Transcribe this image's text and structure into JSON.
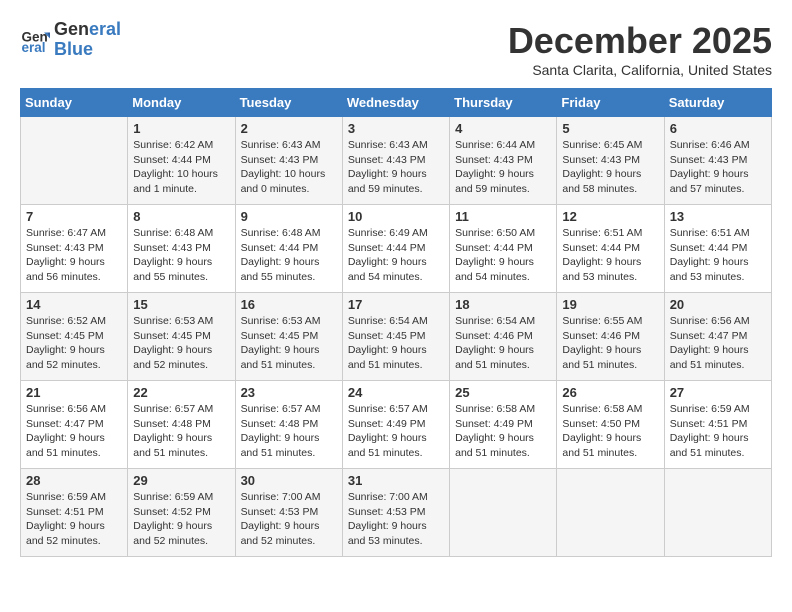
{
  "header": {
    "logo_line1": "General",
    "logo_line2": "Blue",
    "month_title": "December 2025",
    "subtitle": "Santa Clarita, California, United States"
  },
  "weekdays": [
    "Sunday",
    "Monday",
    "Tuesday",
    "Wednesday",
    "Thursday",
    "Friday",
    "Saturday"
  ],
  "weeks": [
    [
      {
        "day": "",
        "info": ""
      },
      {
        "day": "1",
        "info": "Sunrise: 6:42 AM\nSunset: 4:44 PM\nDaylight: 10 hours\nand 1 minute."
      },
      {
        "day": "2",
        "info": "Sunrise: 6:43 AM\nSunset: 4:43 PM\nDaylight: 10 hours\nand 0 minutes."
      },
      {
        "day": "3",
        "info": "Sunrise: 6:43 AM\nSunset: 4:43 PM\nDaylight: 9 hours\nand 59 minutes."
      },
      {
        "day": "4",
        "info": "Sunrise: 6:44 AM\nSunset: 4:43 PM\nDaylight: 9 hours\nand 59 minutes."
      },
      {
        "day": "5",
        "info": "Sunrise: 6:45 AM\nSunset: 4:43 PM\nDaylight: 9 hours\nand 58 minutes."
      },
      {
        "day": "6",
        "info": "Sunrise: 6:46 AM\nSunset: 4:43 PM\nDaylight: 9 hours\nand 57 minutes."
      }
    ],
    [
      {
        "day": "7",
        "info": "Sunrise: 6:47 AM\nSunset: 4:43 PM\nDaylight: 9 hours\nand 56 minutes."
      },
      {
        "day": "8",
        "info": "Sunrise: 6:48 AM\nSunset: 4:43 PM\nDaylight: 9 hours\nand 55 minutes."
      },
      {
        "day": "9",
        "info": "Sunrise: 6:48 AM\nSunset: 4:44 PM\nDaylight: 9 hours\nand 55 minutes."
      },
      {
        "day": "10",
        "info": "Sunrise: 6:49 AM\nSunset: 4:44 PM\nDaylight: 9 hours\nand 54 minutes."
      },
      {
        "day": "11",
        "info": "Sunrise: 6:50 AM\nSunset: 4:44 PM\nDaylight: 9 hours\nand 54 minutes."
      },
      {
        "day": "12",
        "info": "Sunrise: 6:51 AM\nSunset: 4:44 PM\nDaylight: 9 hours\nand 53 minutes."
      },
      {
        "day": "13",
        "info": "Sunrise: 6:51 AM\nSunset: 4:44 PM\nDaylight: 9 hours\nand 53 minutes."
      }
    ],
    [
      {
        "day": "14",
        "info": "Sunrise: 6:52 AM\nSunset: 4:45 PM\nDaylight: 9 hours\nand 52 minutes."
      },
      {
        "day": "15",
        "info": "Sunrise: 6:53 AM\nSunset: 4:45 PM\nDaylight: 9 hours\nand 52 minutes."
      },
      {
        "day": "16",
        "info": "Sunrise: 6:53 AM\nSunset: 4:45 PM\nDaylight: 9 hours\nand 51 minutes."
      },
      {
        "day": "17",
        "info": "Sunrise: 6:54 AM\nSunset: 4:45 PM\nDaylight: 9 hours\nand 51 minutes."
      },
      {
        "day": "18",
        "info": "Sunrise: 6:54 AM\nSunset: 4:46 PM\nDaylight: 9 hours\nand 51 minutes."
      },
      {
        "day": "19",
        "info": "Sunrise: 6:55 AM\nSunset: 4:46 PM\nDaylight: 9 hours\nand 51 minutes."
      },
      {
        "day": "20",
        "info": "Sunrise: 6:56 AM\nSunset: 4:47 PM\nDaylight: 9 hours\nand 51 minutes."
      }
    ],
    [
      {
        "day": "21",
        "info": "Sunrise: 6:56 AM\nSunset: 4:47 PM\nDaylight: 9 hours\nand 51 minutes."
      },
      {
        "day": "22",
        "info": "Sunrise: 6:57 AM\nSunset: 4:48 PM\nDaylight: 9 hours\nand 51 minutes."
      },
      {
        "day": "23",
        "info": "Sunrise: 6:57 AM\nSunset: 4:48 PM\nDaylight: 9 hours\nand 51 minutes."
      },
      {
        "day": "24",
        "info": "Sunrise: 6:57 AM\nSunset: 4:49 PM\nDaylight: 9 hours\nand 51 minutes."
      },
      {
        "day": "25",
        "info": "Sunrise: 6:58 AM\nSunset: 4:49 PM\nDaylight: 9 hours\nand 51 minutes."
      },
      {
        "day": "26",
        "info": "Sunrise: 6:58 AM\nSunset: 4:50 PM\nDaylight: 9 hours\nand 51 minutes."
      },
      {
        "day": "27",
        "info": "Sunrise: 6:59 AM\nSunset: 4:51 PM\nDaylight: 9 hours\nand 51 minutes."
      }
    ],
    [
      {
        "day": "28",
        "info": "Sunrise: 6:59 AM\nSunset: 4:51 PM\nDaylight: 9 hours\nand 52 minutes."
      },
      {
        "day": "29",
        "info": "Sunrise: 6:59 AM\nSunset: 4:52 PM\nDaylight: 9 hours\nand 52 minutes."
      },
      {
        "day": "30",
        "info": "Sunrise: 7:00 AM\nSunset: 4:53 PM\nDaylight: 9 hours\nand 52 minutes."
      },
      {
        "day": "31",
        "info": "Sunrise: 7:00 AM\nSunset: 4:53 PM\nDaylight: 9 hours\nand 53 minutes."
      },
      {
        "day": "",
        "info": ""
      },
      {
        "day": "",
        "info": ""
      },
      {
        "day": "",
        "info": ""
      }
    ]
  ]
}
